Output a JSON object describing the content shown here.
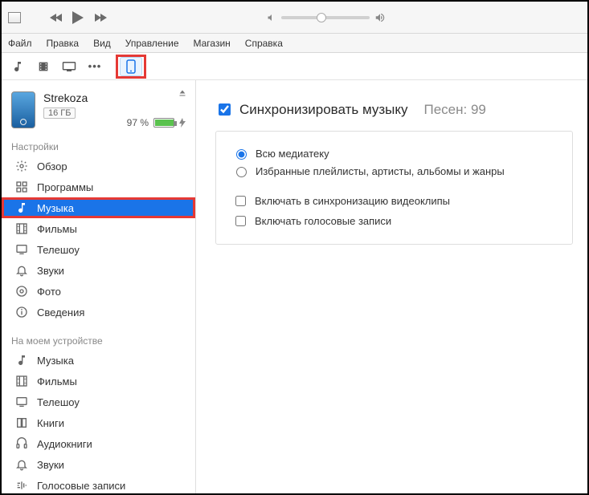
{
  "menu": {
    "file": "Файл",
    "edit": "Правка",
    "view": "Вид",
    "controls": "Управление",
    "store": "Магазин",
    "help": "Справка"
  },
  "device": {
    "name": "Strekoza",
    "capacity": "16 ГБ",
    "battery_pct": "97 %"
  },
  "sidebar": {
    "settings_title": "Настройки",
    "ondevice_title": "На моем устройстве",
    "settings": [
      {
        "label": "Обзор",
        "icon": "settings"
      },
      {
        "label": "Программы",
        "icon": "apps"
      },
      {
        "label": "Музыка",
        "icon": "music"
      },
      {
        "label": "Фильмы",
        "icon": "film"
      },
      {
        "label": "Телешоу",
        "icon": "tv"
      },
      {
        "label": "Звуки",
        "icon": "bell"
      },
      {
        "label": "Фото",
        "icon": "photo"
      },
      {
        "label": "Сведения",
        "icon": "info"
      }
    ],
    "ondevice": [
      {
        "label": "Музыка",
        "icon": "music"
      },
      {
        "label": "Фильмы",
        "icon": "film"
      },
      {
        "label": "Телешоу",
        "icon": "tv"
      },
      {
        "label": "Книги",
        "icon": "book"
      },
      {
        "label": "Аудиокниги",
        "icon": "audiobook"
      },
      {
        "label": "Звуки",
        "icon": "bell"
      },
      {
        "label": "Голосовые записи",
        "icon": "voice"
      }
    ]
  },
  "main": {
    "sync_label": "Синхронизировать музыку",
    "songs_prefix": "Песен: ",
    "songs_count": "99",
    "radio_entire": "Всю медиатеку",
    "radio_selected": "Избранные плейлисты, артисты, альбомы и жанры",
    "chk_videos": "Включать в синхронизацию видеоклипы",
    "chk_voice": "Включать голосовые записи"
  }
}
